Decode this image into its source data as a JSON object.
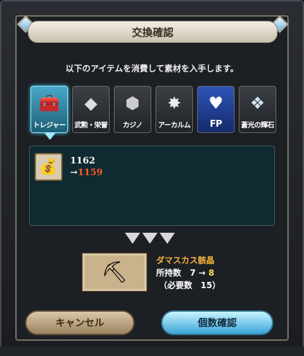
{
  "dialog": {
    "title": "交換確認",
    "subtitle": "以下のアイテムを消費して素材を入手します。"
  },
  "categories": [
    {
      "label": "トレジャー",
      "icon": "treasure-chest-icon",
      "active": true
    },
    {
      "label": "武勲・栄誉",
      "icon": "dice-icon",
      "active": false
    },
    {
      "label": "カジノ",
      "icon": "casino-chip-icon",
      "active": false
    },
    {
      "label": "アーカルム",
      "icon": "star-burst-icon",
      "active": false
    },
    {
      "label": "FP",
      "icon": "heart-icon",
      "active": false
    },
    {
      "label": "蒼光の輝石",
      "icon": "crystal-icon",
      "active": false
    }
  ],
  "cost_item": {
    "icon": "coin-bag-icon",
    "current": "1162",
    "arrow": "→",
    "after": "1159"
  },
  "reward": {
    "icon": "damascus-crystal-icon",
    "name": "ダマスカス骸晶",
    "hold_label": "所持数",
    "hold_before": "7",
    "hold_arrow": "→",
    "hold_after": "8",
    "required_text": "（必要数　15）"
  },
  "buttons": {
    "cancel": "キャンセル",
    "confirm": "個数確認"
  },
  "colors": {
    "accent": "#4ad8ff",
    "after_value": "#ff5a2a",
    "reward_name": "#f6b23a"
  }
}
